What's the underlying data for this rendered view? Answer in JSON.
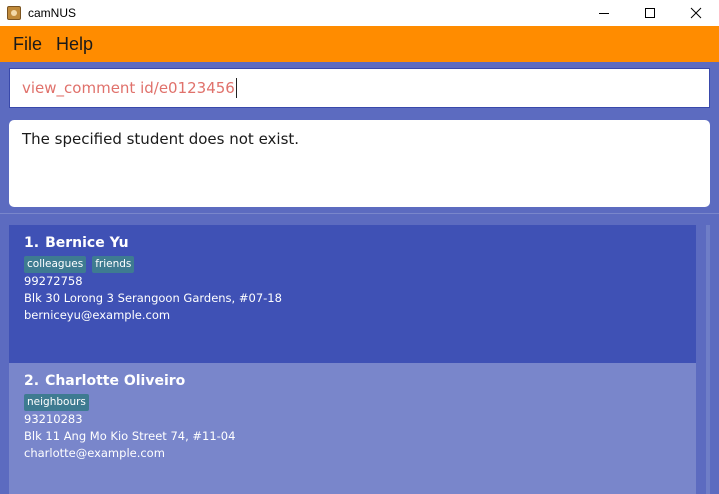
{
  "window": {
    "title": "camNUS",
    "controls": [
      "minimize-icon",
      "maximize-icon",
      "close-icon"
    ]
  },
  "menu": {
    "items": [
      {
        "label": "File"
      },
      {
        "label": "Help"
      }
    ]
  },
  "command_box": {
    "value": "view_comment id/e0123456"
  },
  "result_box": {
    "message": "The specified student does not exist."
  },
  "person_list": {
    "persons": [
      {
        "index": "1.",
        "name": "Bernice Yu",
        "tags": [
          "colleagues",
          "friends"
        ],
        "phone": "99272758",
        "address": "Blk 30 Lorong 3 Serangoon Gardens, #07-18",
        "email": "berniceyu@example.com"
      },
      {
        "index": "2.",
        "name": "Charlotte Oliveiro",
        "tags": [
          "neighbours"
        ],
        "phone": "93210283",
        "address": "Blk 11 Ang Mo Kio Street 74, #11-04",
        "email": "charlotte@example.com"
      }
    ]
  },
  "colors": {
    "menu_bar": "#ff8c00",
    "background": "#5c6bc0",
    "selected_card": "#3f51b5",
    "card": "#7986cb",
    "tag": "#3e7b91",
    "command_text": "#e0716b"
  }
}
